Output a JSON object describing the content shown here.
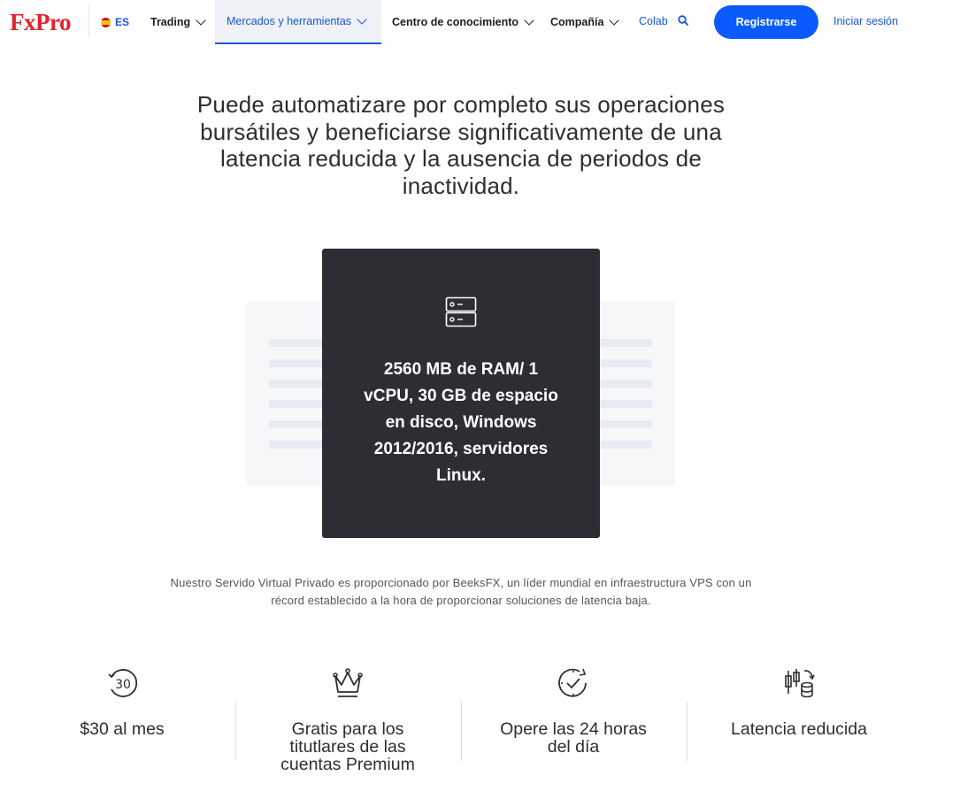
{
  "header": {
    "logo": "FxPro",
    "language": "ES",
    "nav": [
      {
        "label": "Trading"
      },
      {
        "label": "Mercados y herramientas"
      },
      {
        "label": "Centro de conocimiento"
      },
      {
        "label": "Compañía"
      }
    ],
    "colab": "Colab",
    "register": "Registrarse",
    "login": "Iniciar sesión"
  },
  "hero": {
    "text": "Puede automatizare por completo sus operaciones bursátiles y beneficiarse significativamente de una latencia reducida y la ausencia de periodos de inactividad."
  },
  "card": {
    "icon": "server-icon",
    "text": "2560 MB de RAM/ 1 vCPU, 30 GB de espacio en disco, Windows 2012/2016, servidores Linux."
  },
  "provider_text": "Nuestro Servido Virtual Privado es proporcionado por BeeksFX, un líder mundial en infraestructura VPS con un récord establecido a la hora de proporcionar soluciones de latencia baja.",
  "features": [
    {
      "icon": "thirty-icon",
      "label": "$30 al mes"
    },
    {
      "icon": "crown-icon",
      "label": "Gratis para los titutlares de las cuentas Premium"
    },
    {
      "icon": "clock-check-icon",
      "label": "Opere las 24 horas del día"
    },
    {
      "icon": "candles-coins-icon",
      "label": "Latencia reducida"
    }
  ],
  "colors": {
    "brand_red": "#e1242a",
    "accent_blue": "#0a5bff",
    "dark_card": "#2d2e33"
  }
}
